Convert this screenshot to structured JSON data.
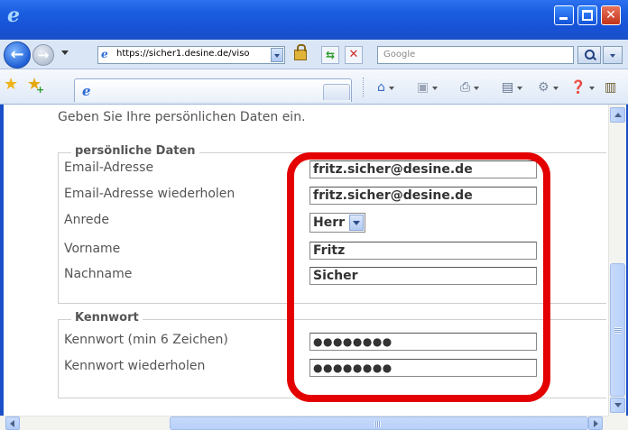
{
  "window": {
    "title_icon": "ie-logo",
    "controls": [
      "minimize",
      "maximize",
      "close"
    ]
  },
  "navbar": {
    "url": "https://sicher1.desine.de/viso",
    "search_placeholder": "Google"
  },
  "page": {
    "intro": "Geben Sie Ihre persönlichen Daten ein.",
    "personal": {
      "legend": "persönliche Daten",
      "email_label": "Email-Adresse",
      "email_value": "fritz.sicher@desine.de",
      "email_repeat_label": "Email-Adresse wiederholen",
      "email_repeat_value": "fritz.sicher@desine.de",
      "salutation_label": "Anrede",
      "salutation_value": "Herr",
      "firstname_label": "Vorname",
      "firstname_value": "Fritz",
      "lastname_label": "Nachname",
      "lastname_value": "Sicher"
    },
    "password": {
      "legend": "Kennwort",
      "password_label": "Kennwort (min 6 Zeichen)",
      "password_value": "●●●●●●●●",
      "password_repeat_label": "Kennwort wiederholen",
      "password_repeat_value": "●●●●●●●●"
    }
  },
  "colors": {
    "highlight": "#e40000",
    "titlebar": "#1c5ee0"
  }
}
